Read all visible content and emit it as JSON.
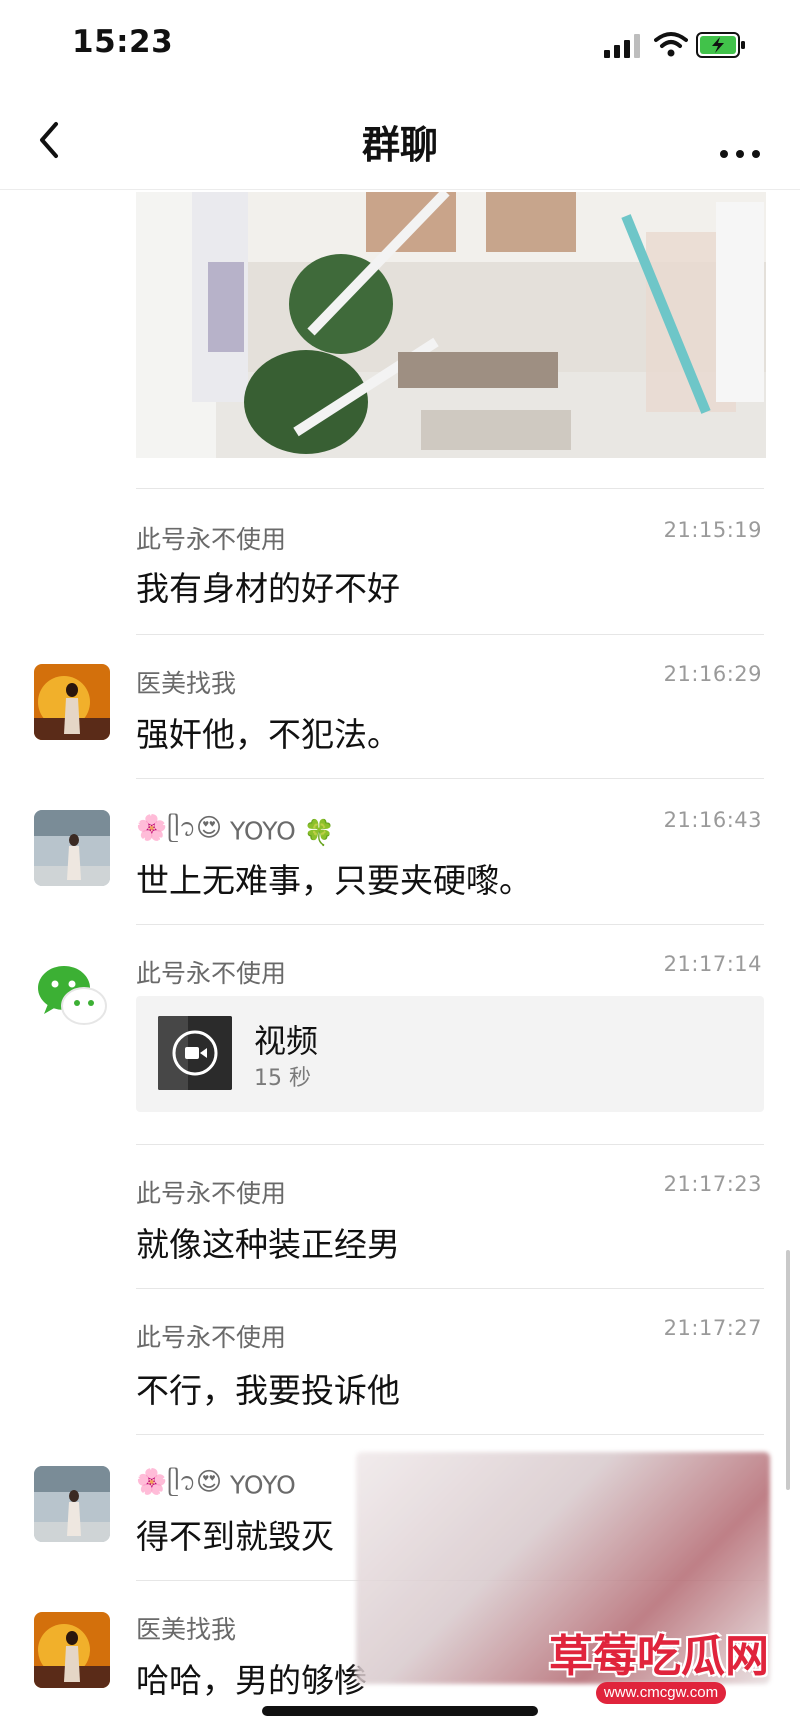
{
  "status_bar": {
    "time": "15:23"
  },
  "nav": {
    "title": "群聊"
  },
  "icons": [
    "back-icon",
    "more-icon",
    "signal-icon",
    "wifi-icon",
    "battery-charging-icon",
    "video-play-icon",
    "wechat-logo-icon"
  ],
  "messages": [
    {
      "sender": "此号永不使用",
      "time": "21:15:19",
      "text": "我有身材的好不好"
    },
    {
      "sender": "医美找我",
      "time": "21:16:29",
      "text": "强奸他，不犯法。"
    },
    {
      "sender_prefix": "🌸ᥫ᭡😍",
      "sender_name": "YOYO",
      "sender_suffix": "🍀",
      "time": "21:16:43",
      "text": "世上无难事，只要夹硬嚟。"
    },
    {
      "sender": "此号永不使用",
      "time": "21:17:14",
      "video": {
        "title": "视频",
        "duration": "15 秒"
      }
    },
    {
      "sender": "此号永不使用",
      "time": "21:17:23",
      "text": "就像这种装正经男"
    },
    {
      "sender": "此号永不使用",
      "time": "21:17:27",
      "text": "不行，我要投诉他"
    },
    {
      "sender_prefix": "🌸ᥫ᭡😍",
      "sender_name": "YOYO",
      "text": "得不到就毁灭"
    },
    {
      "sender": "医美找我",
      "text": "哈哈，男的够惨"
    }
  ],
  "watermark": {
    "title": "草莓吃瓜网",
    "url": "www.cmcgw.com"
  },
  "colors": {
    "accent_red": "#e0243c",
    "wechat_green": "#3cb034",
    "text_primary": "#111111",
    "text_secondary": "#6a6a6a"
  }
}
